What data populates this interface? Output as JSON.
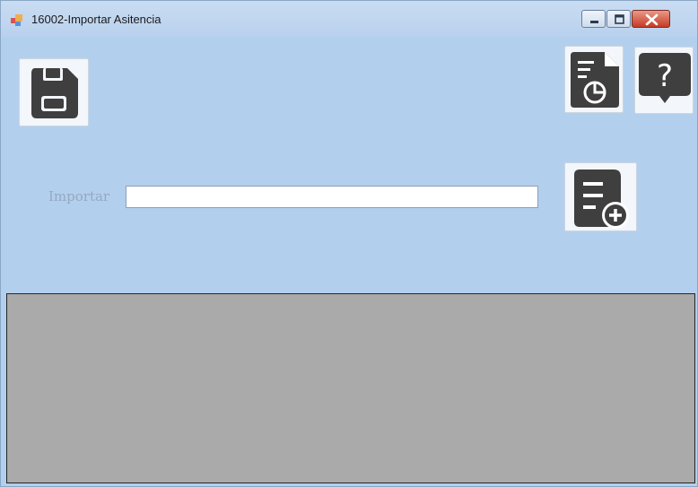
{
  "window": {
    "title": "16002-Importar Asitencia",
    "controls": [
      "minimize-icon",
      "maximize-icon",
      "close-icon"
    ]
  },
  "toolbar": {
    "buttons": [
      {
        "name": "save",
        "icon": "floppy-disk-icon"
      },
      {
        "name": "report",
        "icon": "document-chart-icon"
      },
      {
        "name": "help",
        "icon": "question-bubble-icon"
      }
    ]
  },
  "import": {
    "label": "Importar",
    "value": "",
    "add_file_icon": "document-add-icon"
  },
  "colors": {
    "background": "#b3cfee",
    "grid": "#aaaaaa",
    "icon": "#3f3f3f"
  }
}
